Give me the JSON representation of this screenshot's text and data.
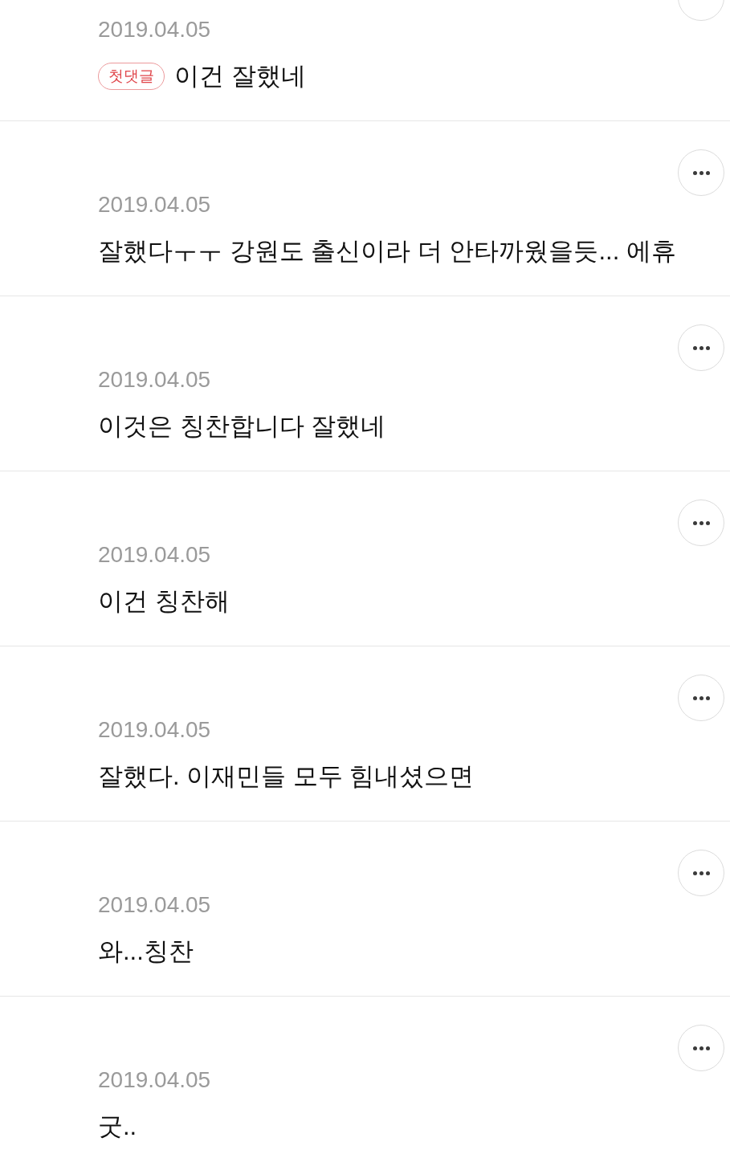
{
  "comments": [
    {
      "date": "2019.04.05",
      "badge": "첫댓글",
      "text": "이건 잘했네"
    },
    {
      "date": "2019.04.05",
      "text": "잘했다ㅜㅜ 강원도 출신이라 더 안타까웠을듯... 에휴"
    },
    {
      "date": "2019.04.05",
      "text": "이것은 칭찬합니다 잘했네"
    },
    {
      "date": "2019.04.05",
      "text": "이건 칭찬해"
    },
    {
      "date": "2019.04.05",
      "text": "잘했다. 이재민들 모두 힘내셨으면"
    },
    {
      "date": "2019.04.05",
      "text": "와...칭찬"
    },
    {
      "date": "2019.04.05",
      "text": "굿.."
    }
  ]
}
